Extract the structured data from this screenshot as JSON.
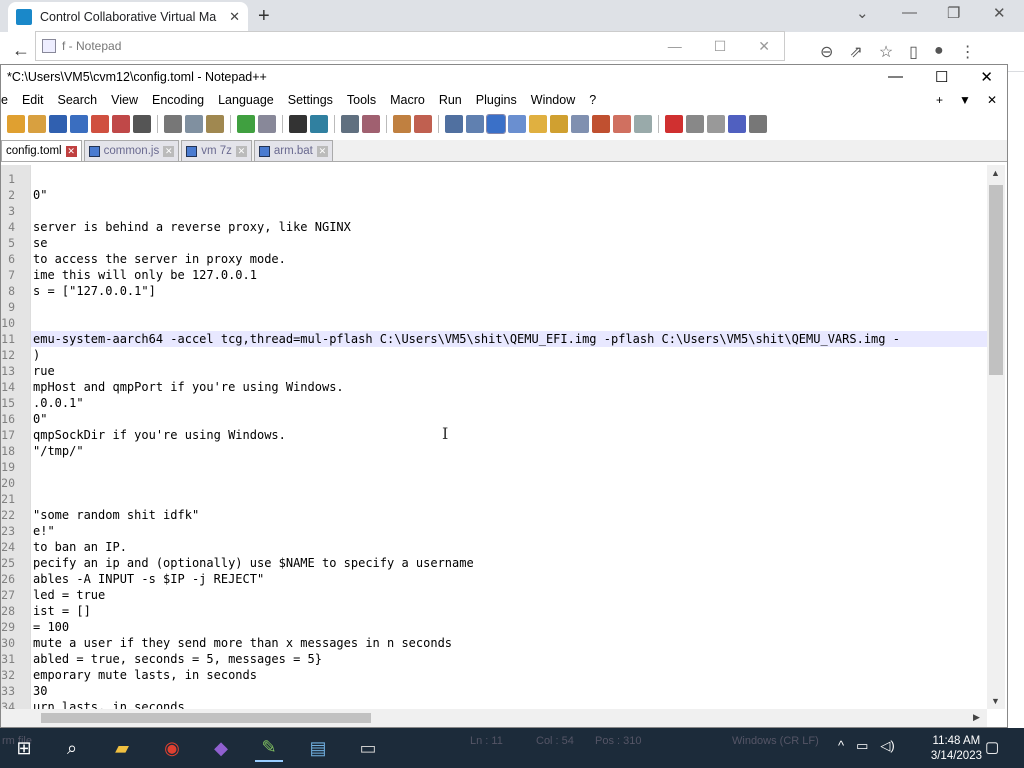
{
  "browser": {
    "tab_title": "Control Collaborative Virtual Ma",
    "new_tab": "+",
    "minimize": "⌄",
    "restore": "—",
    "max": "❐",
    "close": "✕"
  },
  "notepad": {
    "title": "f - Notepad"
  },
  "npp": {
    "title": "*C:\\Users\\VM5\\cvm12\\config.toml - Notepad++",
    "menu": [
      "e",
      "Edit",
      "Search",
      "View",
      "Encoding",
      "Language",
      "Settings",
      "Tools",
      "Macro",
      "Run",
      "Plugins",
      "Window",
      "?"
    ],
    "menu_right": [
      "+",
      "▼",
      "✕"
    ],
    "tabs": [
      {
        "label": "config.toml",
        "active": true
      },
      {
        "label": "common.js",
        "active": false
      },
      {
        "label": "vm 7z",
        "active": false
      },
      {
        "label": "arm.bat",
        "active": false
      }
    ],
    "lines": [
      {
        "n": "1",
        "text": ""
      },
      {
        "n": "2",
        "text": "0\""
      },
      {
        "n": "3",
        "text": ""
      },
      {
        "n": "4",
        "text": "server is behind a reverse proxy, like NGINX"
      },
      {
        "n": "5",
        "text": "se"
      },
      {
        "n": "6",
        "text": "to access the server in proxy mode."
      },
      {
        "n": "7",
        "text": "ime this will only be 127.0.0.1"
      },
      {
        "n": "8",
        "text": "s = [\"127.0.0.1\"]"
      },
      {
        "n": "9",
        "text": ""
      },
      {
        "n": "10",
        "text": ""
      },
      {
        "n": "11",
        "text": "emu-system-aarch64 -accel tcg,thread=mul-pflash C:\\Users\\VM5\\shit\\QEMU_EFI.img -pflash C:\\Users\\VM5\\shit\\QEMU_VARS.img -"
      },
      {
        "n": "12",
        "text": ")"
      },
      {
        "n": "13",
        "text": "rue"
      },
      {
        "n": "14",
        "text": "mpHost and qmpPort if you're using Windows."
      },
      {
        "n": "15",
        "text": ".0.0.1\""
      },
      {
        "n": "16",
        "text": "0\""
      },
      {
        "n": "17",
        "text": "qmpSockDir if you're using Windows."
      },
      {
        "n": "18",
        "text": "\"/tmp/\""
      },
      {
        "n": "19",
        "text": ""
      },
      {
        "n": "20",
        "text": ""
      },
      {
        "n": "21",
        "text": ""
      },
      {
        "n": "22",
        "text": "\"some random shit idfk\""
      },
      {
        "n": "23",
        "text": "e!\""
      },
      {
        "n": "24",
        "text": "to ban an IP."
      },
      {
        "n": "25",
        "text": "pecify an ip and (optionally) use $NAME to specify a username"
      },
      {
        "n": "26",
        "text": "ables -A INPUT -s $IP -j REJECT\""
      },
      {
        "n": "27",
        "text": "led = true"
      },
      {
        "n": "28",
        "text": "ist = []"
      },
      {
        "n": "29",
        "text": "= 100"
      },
      {
        "n": "30",
        "text": "mute a user if they send more than x messages in n seconds"
      },
      {
        "n": "31",
        "text": "abled = true, seconds = 5, messages = 5}"
      },
      {
        "n": "32",
        "text": "emporary mute lasts, in seconds"
      },
      {
        "n": "33",
        "text": "30"
      },
      {
        "n": "34",
        "text": "urn lasts, in seconds"
      }
    ],
    "current_line": "11"
  },
  "statusbar": {
    "ln": "Ln : 11",
    "col": "Col : 54",
    "pos": "Pos : 310",
    "eol": "Windows (CR LF)",
    "ghost_left": "rm  file"
  },
  "taskbar": {
    "time": "11:48 AM",
    "date": "3/14/2023"
  }
}
